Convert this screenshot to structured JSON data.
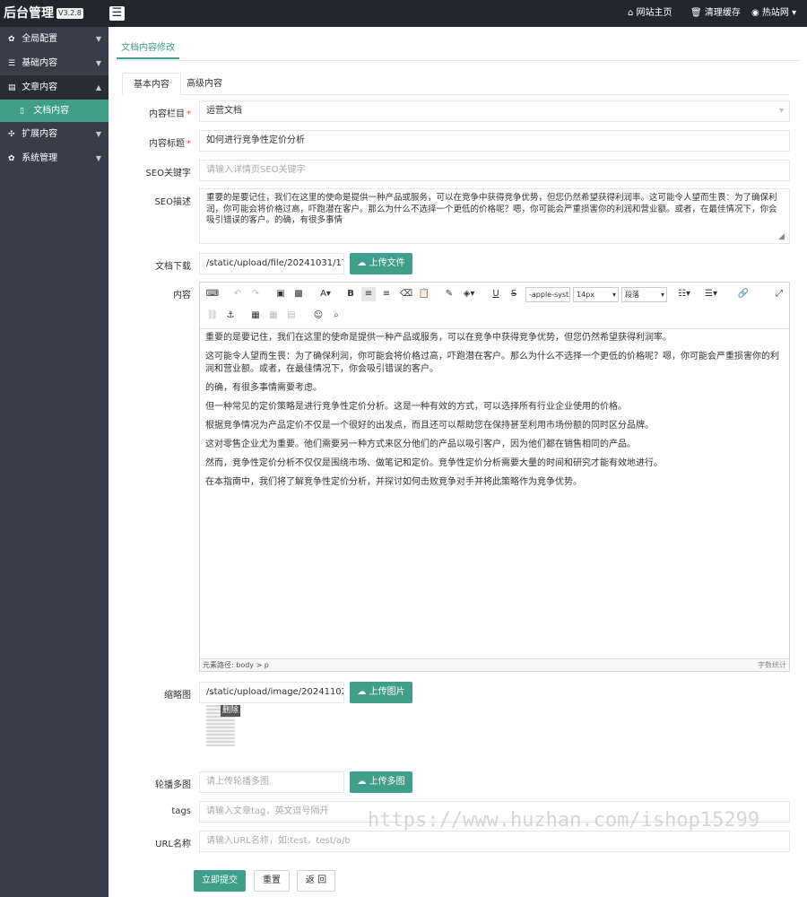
{
  "header": {
    "title": "后台管理",
    "version": "V3.2.8",
    "links": [
      {
        "icon": "home-icon",
        "label": "网站主页"
      },
      {
        "icon": "trash-icon",
        "label": "清理缓存"
      },
      {
        "icon": "user-icon",
        "label": "热站网"
      }
    ]
  },
  "sidebar": {
    "items": [
      {
        "label": "全局配置",
        "icon": "gear-icon"
      },
      {
        "label": "基础内容",
        "icon": "sliders-icon"
      },
      {
        "label": "文章内容",
        "icon": "document-icon"
      },
      {
        "label": "文档内容",
        "icon": "file-icon"
      },
      {
        "label": "扩展内容",
        "icon": "expand-icon"
      },
      {
        "label": "系统管理",
        "icon": "gear-icon"
      }
    ]
  },
  "page_tab": "文档内容修改",
  "tabs": [
    "基本内容",
    "高级内容"
  ],
  "form": {
    "column": {
      "label": "内容栏目",
      "value": "运营文档"
    },
    "title": {
      "label": "内容标题",
      "value": "如何进行竞争性定价分析"
    },
    "seo_keywords": {
      "label": "SEO关键字",
      "placeholder": "请输入详情页SEO关键字"
    },
    "seo_desc": {
      "label": "SEO描述",
      "value": "重要的是要记住，我们在这里的使命是提供一种产品或服务，可以在竞争中获得竞争优势，但您仍然希望获得利润率。这可能令人望而生畏：为了确保利润，你可能会将价格过高，吓跑潜在客户。那么为什么不选择一个更低的价格呢？嗯，你可能会严重损害你的利润和营业额。或者，在最佳情况下，你会吸引错误的客户。的确，有很多事情"
    },
    "download": {
      "label": "文档下载",
      "value": "/static/upload/file/20241031/173037696",
      "button": "上传文件"
    },
    "content": {
      "label": "内容"
    },
    "thumb": {
      "label": "缩略图",
      "value": "/static/upload/image/20241102/173055",
      "button": "上传图片",
      "delete": "删除"
    },
    "gallery": {
      "label": "轮播多图",
      "placeholder": "请上传轮播多图",
      "button": "上传多图"
    },
    "tags": {
      "label": "tags",
      "placeholder": "请输入文章tag，英文逗号隔开"
    },
    "url": {
      "label": "URL名称",
      "placeholder": "请输入URL名称，如:test，test/a/b"
    }
  },
  "editor": {
    "font_family": "-apple-syst",
    "font_size": "14px",
    "paragraph": "段落",
    "paragraphs": [
      "重要的是要记住，我们在这里的使命是提供一种产品或服务，可以在竞争中获得竞争优势，但您仍然希望获得利润率。",
      "这可能令人望而生畏：为了确保利润，你可能会将价格过高，吓跑潜在客户。那么为什么不选择一个更低的价格呢？嗯，你可能会严重损害你的利润和营业额。或者，在最佳情况下，你会吸引错误的客户。",
      "的确，有很多事情需要考虑。",
      "但一种常见的定价策略是进行竞争性定价分析。这是一种有效的方式，可以选择所有行业企业使用的价格。",
      "根据竞争情况为产品定价不仅是一个很好的出发点，而且还可以帮助您在保持甚至利用市场份额的同时区分品牌。",
      "这对零售企业尤为重要。他们需要另一种方式来区分他们的产品以吸引客户，因为他们都在销售相同的产品。",
      "然而，竞争性定价分析不仅仅是围绕市场、做笔记和定价。竞争性定价分析需要大量的时间和研究才能有效地进行。",
      "在本指南中，我们将了解竞争性定价分析，并探讨如何击败竞争对手并将此策略作为竞争优势。"
    ],
    "path": "元素路径: body > p",
    "count": "字数统计"
  },
  "actions": {
    "submit": "立即提交",
    "reset": "重置",
    "back": "返 回"
  },
  "watermark": "https://www.huzhan.com/ishop15299",
  "colors": {
    "accent": "#3f9f8a",
    "sidebar": "#393d49",
    "topbar": "#23262e"
  }
}
